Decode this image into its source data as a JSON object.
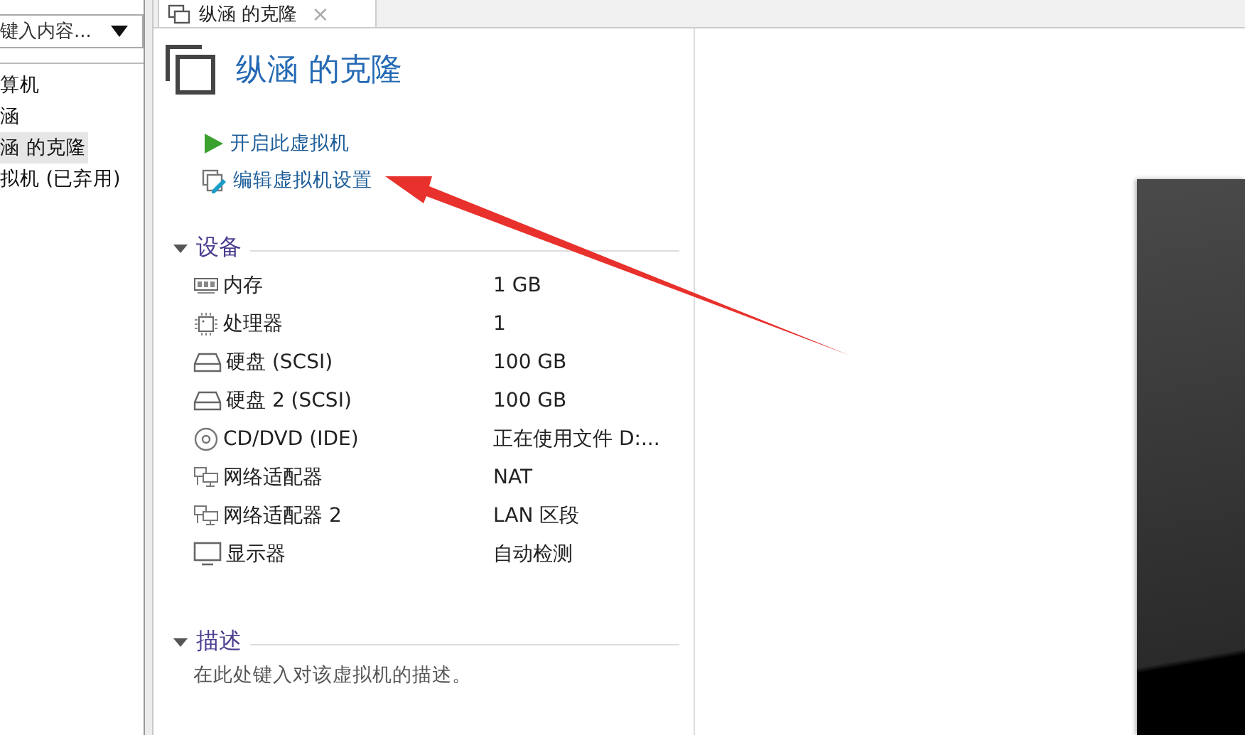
{
  "sidebar": {
    "search": {
      "placeholder": "键入内容..."
    },
    "items": [
      {
        "label": "算机",
        "selected": false
      },
      {
        "label": "涵",
        "selected": false
      },
      {
        "label": "涵 的克隆",
        "selected": true
      },
      {
        "label": "拟机 (已弃用)",
        "selected": false
      }
    ]
  },
  "tab": {
    "title": "纵涵 的克隆",
    "close": "×"
  },
  "vm": {
    "title": "纵涵 的克隆",
    "actions": [
      {
        "kind": "power_on",
        "label": "开启此虚拟机"
      },
      {
        "kind": "edit",
        "label": "编辑虚拟机设置"
      }
    ],
    "devices": {
      "title": "设备",
      "expanded": true,
      "items": [
        {
          "kind": "memory",
          "name": "内存",
          "value": "1 GB"
        },
        {
          "kind": "cpu",
          "name": "处理器",
          "value": "1"
        },
        {
          "kind": "disk",
          "name": "硬盘 (SCSI)",
          "value": "100 GB"
        },
        {
          "kind": "disk",
          "name": "硬盘 2 (SCSI)",
          "value": "100 GB"
        },
        {
          "kind": "cdrom",
          "name": "CD/DVD (IDE)",
          "value": "正在使用文件 D:..."
        },
        {
          "kind": "network",
          "name": "网络适配器",
          "value": "NAT"
        },
        {
          "kind": "network",
          "name": "网络适配器 2",
          "value": "LAN 区段"
        },
        {
          "kind": "display",
          "name": "显示器",
          "value": "自动检测"
        }
      ]
    },
    "description": {
      "title": "描述",
      "expanded": true,
      "placeholder": "在此处键入对该虚拟机的描述。"
    }
  }
}
